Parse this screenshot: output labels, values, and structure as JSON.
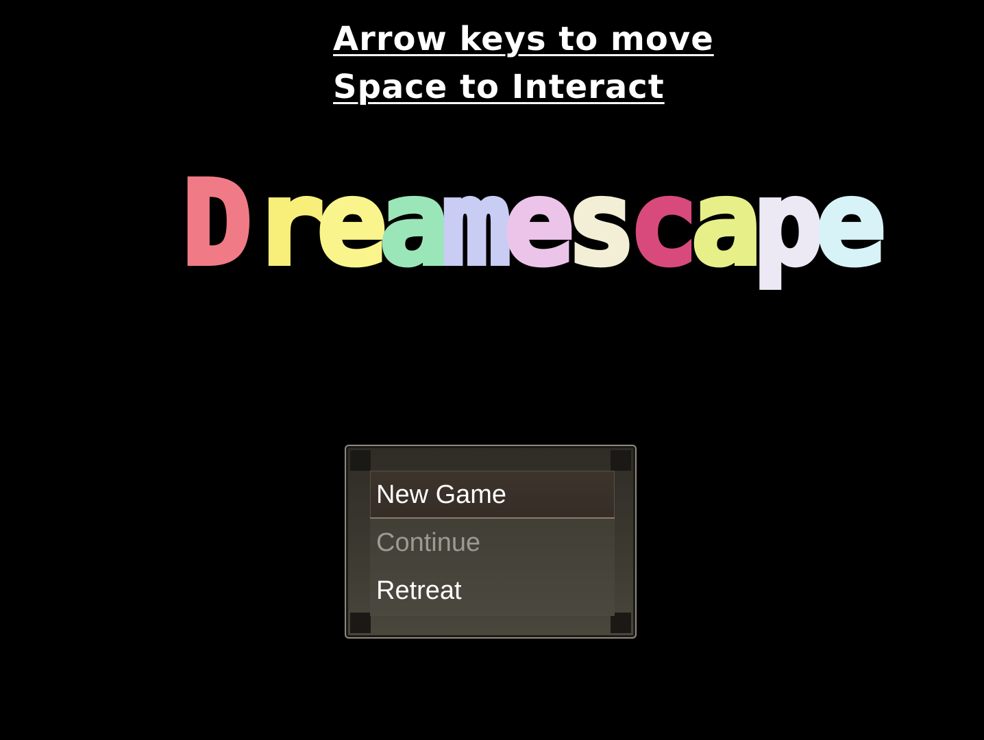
{
  "instructions": {
    "line1": "Arrow keys to move",
    "line2": "Space to Interact"
  },
  "title": {
    "text": "Dreamescape",
    "letters": [
      {
        "char": "D",
        "color": "#f07b86"
      },
      {
        "char": "r",
        "color": "#f8ef7a"
      },
      {
        "char": "e",
        "color": "#f9f58c"
      },
      {
        "char": "a",
        "color": "#9be6b8"
      },
      {
        "char": "m",
        "color": "#c9ccf3"
      },
      {
        "char": "e",
        "color": "#ecc4ea"
      },
      {
        "char": "s",
        "color": "#f3efd6"
      },
      {
        "char": "c",
        "color": "#d84a7c"
      },
      {
        "char": "a",
        "color": "#e7f088"
      },
      {
        "char": "p",
        "color": "#ece8f4"
      },
      {
        "char": "e",
        "color": "#d8f3f7"
      }
    ]
  },
  "menu": {
    "items": [
      {
        "label": "New Game",
        "state": "selected"
      },
      {
        "label": "Continue",
        "state": "disabled"
      },
      {
        "label": "Retreat",
        "state": "enabled"
      }
    ]
  },
  "colors": {
    "background": "#000000",
    "text": "#ffffff",
    "disabled_text": "#9c9a93"
  }
}
